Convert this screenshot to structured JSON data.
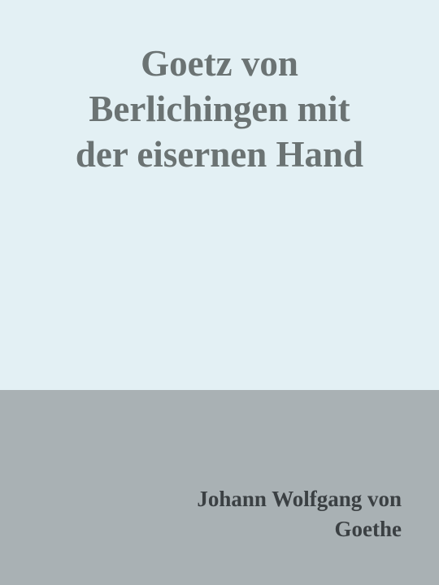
{
  "cover": {
    "title_lines": [
      "Goetz von",
      "Berlichingen mit",
      "der eisernen Hand"
    ],
    "author_lines": [
      "Johann Wolfgang von",
      "Goethe"
    ],
    "colors": {
      "top_background": "#e3f0f4",
      "bottom_background": "#a9b1b4",
      "title_text": "#6b7373",
      "author_text": "#3b4043"
    }
  }
}
